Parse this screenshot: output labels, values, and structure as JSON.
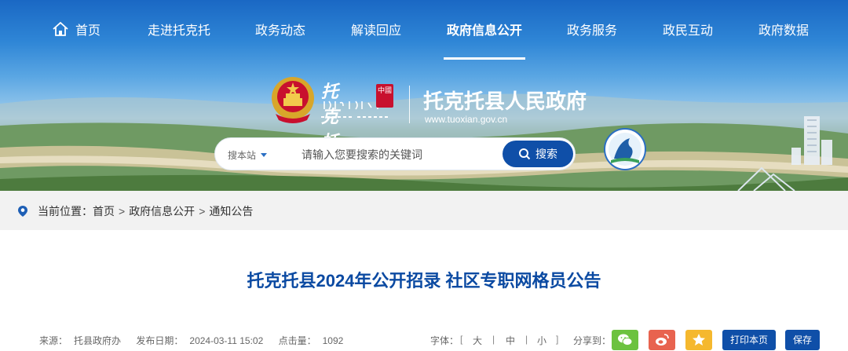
{
  "nav": {
    "items": [
      {
        "label": "首页"
      },
      {
        "label": "走进托克托"
      },
      {
        "label": "政务动态"
      },
      {
        "label": "解读回应"
      },
      {
        "label": "政府信息公开"
      },
      {
        "label": "政务服务"
      },
      {
        "label": "政民互动"
      },
      {
        "label": "政府数据"
      }
    ],
    "active": "政府信息公开"
  },
  "logo": {
    "calligraphy": "托克托",
    "seal": "中國",
    "site_name": "托克托县人民政府",
    "url": "www.tuoxian.gov.cn"
  },
  "search": {
    "scope": "搜本站",
    "placeholder": "请输入您要搜索的关键词",
    "button": "搜索"
  },
  "breadcrumb": {
    "prefix": "当前位置：",
    "items": [
      "首页",
      "政府信息公开",
      "通知公告"
    ],
    "sep": ">"
  },
  "article": {
    "title": "托克托县2024年公开招录 社区专职网格员公告",
    "source_label": "来源：",
    "source": "托县政府办",
    "date_label": "发布日期：",
    "date": "2024-03-11 15:02",
    "views_label": "点击量：",
    "views": "1092"
  },
  "tools": {
    "font_label": "字体：",
    "bracket_open": "[",
    "bracket_close": "]",
    "sizes": [
      "大",
      "中",
      "小"
    ],
    "sep": "|",
    "share_label": "分享到：",
    "print": "打印本页",
    "save": "保存"
  },
  "colors": {
    "accent": "#0f4fa8",
    "title": "#0b4aa2",
    "wechat": "#6cc23f",
    "weibo": "#e8634f",
    "qzone": "#f5b82e"
  }
}
